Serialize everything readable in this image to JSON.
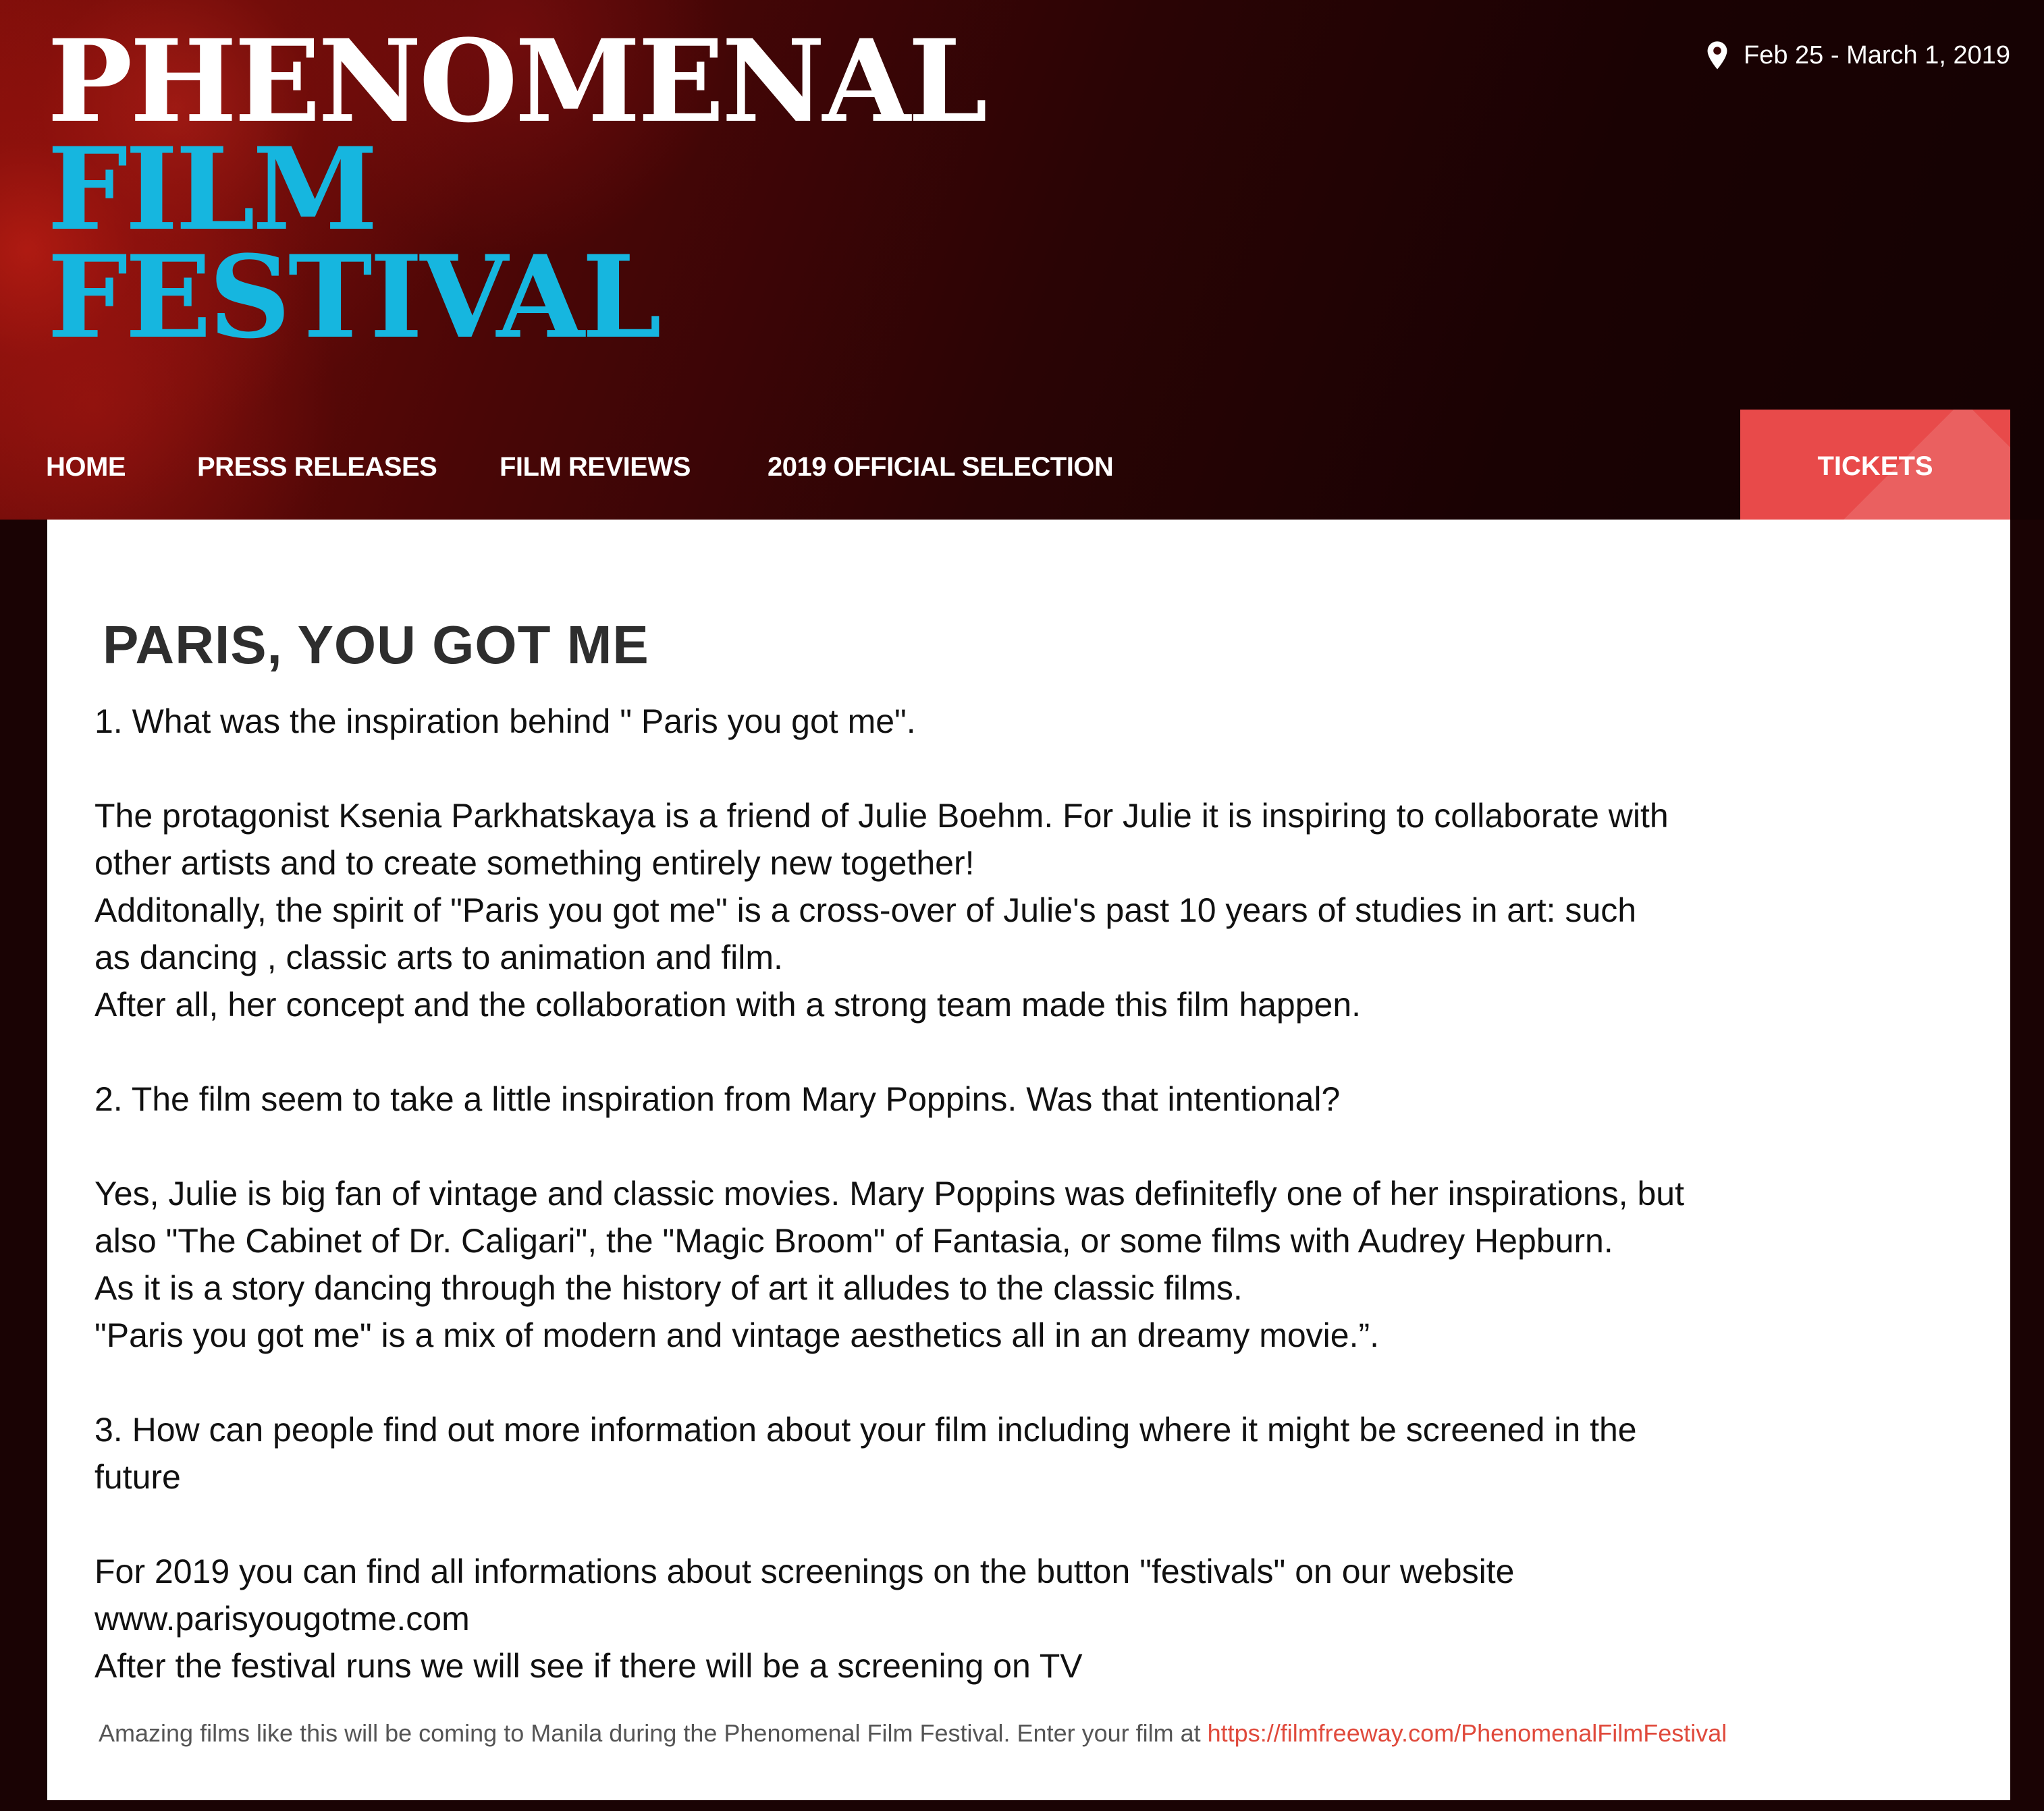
{
  "site": {
    "title_line1": "PHENOMENAL",
    "title_line2": "FILM",
    "title_line3": "FESTIVAL",
    "date": "Feb 25 - March 1, 2019",
    "date_icon": "map-pin-icon"
  },
  "nav": {
    "items": [
      {
        "label": "HOME"
      },
      {
        "label": "PRESS RELEASES"
      },
      {
        "label": "FILM REVIEWS"
      },
      {
        "label": "2019 OFFICIAL SELECTION"
      }
    ],
    "tickets_label": "TICKETS"
  },
  "article": {
    "title": "PARIS, YOU GOT ME",
    "lines": [
      "1. What was the inspiration behind \" Paris you got me\".",
      "",
      "The protagonist Ksenia Parkhatskaya is a friend of Julie Boehm. For Julie it is inspiring to collaborate with",
      "other artists and to create something entirely new together!",
      "Additonally, the spirit of \"Paris you got me\" is a cross-over of Julie's past 10 years of studies in art: such",
      "as dancing , classic arts to animation and film.",
      "After all, her concept and the collaboration with a strong team made this film happen.",
      "",
      "2. The film seem to take a little inspiration from Mary Poppins. Was that intentional?",
      "",
      "Yes, Julie is big fan of vintage and classic movies. Mary Poppins was definitefly one of her inspirations, but",
      "also \"The Cabinet of Dr. Caligari\",  the \"Magic Broom\" of Fantasia, or some films with Audrey Hepburn.",
      "As it is a story dancing through the history of art it alludes to the classic films.",
      "\"Paris you got me\" is a  mix of modern and vintage aesthetics all in an dreamy movie.”.",
      "",
      "3. How can people find out more information about your film including where it might be screened in the",
      "future",
      "",
      "For 2019 you can find all informations about screenings on the button \"festivals\" on our website",
      "www.parisyougotme.com",
      "After the festival runs we will see if there will be a screening on TV"
    ],
    "footer_text": "Amazing films like this will be coming to Manila during the Phenomenal Film Festival. Enter your film at ",
    "footer_link": "https://filmfreeway.com/PhenomenalFilmFestival"
  },
  "colors": {
    "title_white": "#ffffff",
    "title_blue": "#16b6df",
    "tickets_bg": "#e84a4a",
    "link_red": "#e04a3c"
  }
}
